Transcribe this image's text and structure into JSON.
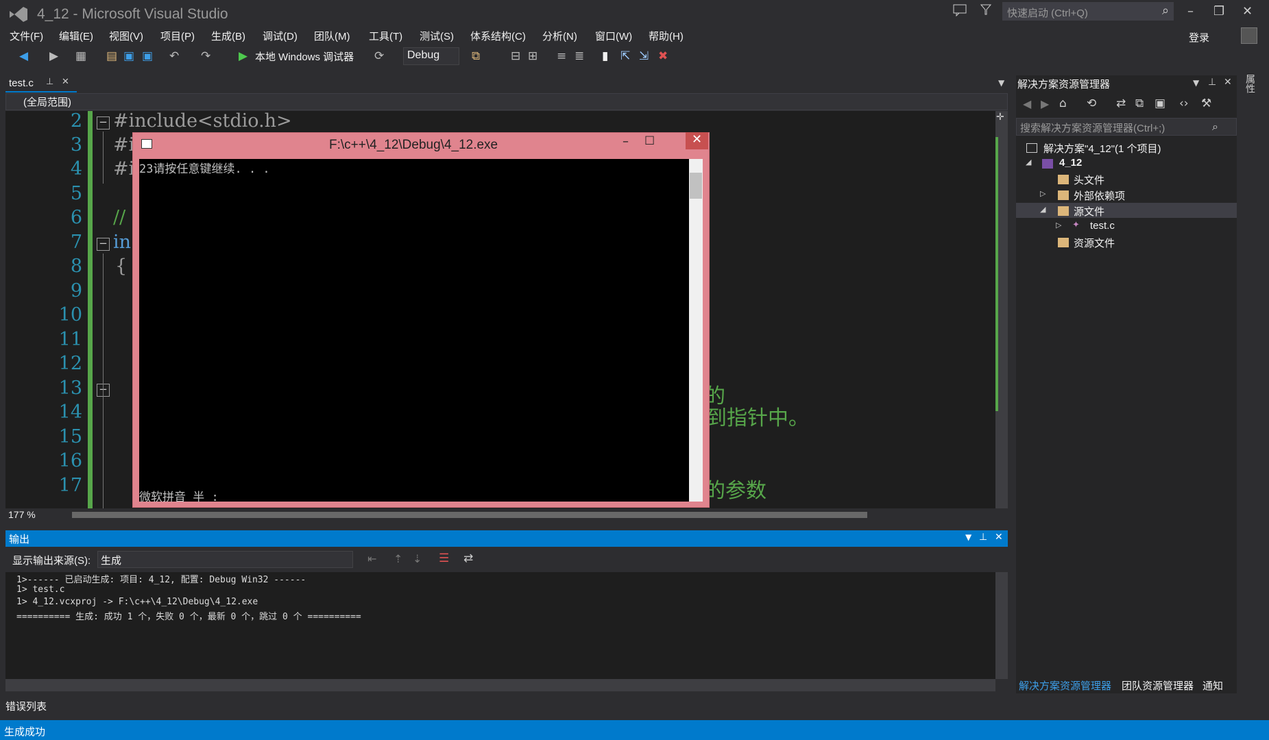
{
  "window": {
    "title": "4_12 - Microsoft Visual Studio",
    "quick_launch_placeholder": "快速启动 (Ctrl+Q)",
    "login": "登录"
  },
  "menu": [
    "文件(F)",
    "编辑(E)",
    "视图(V)",
    "项目(P)",
    "生成(B)",
    "调试(D)",
    "团队(M)",
    "工具(T)",
    "测试(S)",
    "体系结构(C)",
    "分析(N)",
    "窗口(W)",
    "帮助(H)"
  ],
  "toolbar": {
    "run_label": "本地 Windows 调试器",
    "config": "Debug"
  },
  "editor": {
    "tab": "test.c",
    "scope": "(全局范围)",
    "zoom": "177 %",
    "line_numbers": [
      "2",
      "3",
      "4",
      "5",
      "6",
      "7",
      "8",
      "9",
      "10",
      "11",
      "12",
      "13",
      "14",
      "15",
      "16",
      "17"
    ],
    "code": {
      "l2": "#include<stdio.h>",
      "l3": "#i",
      "l4": "#i",
      "l6": "//",
      "l7": "in",
      "l8": "{"
    },
    "comment_13": "的",
    "comment_14": "到指针中。",
    "comment_17": "的参数"
  },
  "console": {
    "title": "F:\\c++\\4_12\\Debug\\4_12.exe",
    "output": "23请按任意键继续. . .",
    "ime": "微软拼音 半 :"
  },
  "output_pane": {
    "title": "输出",
    "source_label": "显示输出来源(S):",
    "source_value": "生成",
    "lines": [
      "1>------ 已启动生成:  项目: 4_12, 配置: Debug Win32 ------",
      "1>  test.c",
      "1>  4_12.vcxproj -> F:\\c++\\4_12\\Debug\\4_12.exe",
      "========== 生成:  成功 1 个，失败 0 个，最新 0 个，跳过 0 个 =========="
    ],
    "error_list_tab": "错误列表"
  },
  "solution_explorer": {
    "title": "解决方案资源管理器",
    "search_placeholder": "搜索解决方案资源管理器(Ctrl+;)",
    "tree": {
      "solution": "解决方案\"4_12\"(1 个项目)",
      "project": "4_12",
      "headers": "头文件",
      "external": "外部依赖项",
      "sources": "源文件",
      "file": "test.c",
      "resources": "资源文件"
    },
    "bottom_tabs": [
      "解决方案资源管理器",
      "团队资源管理器",
      "通知"
    ],
    "side_strip": "属性"
  },
  "status": {
    "text": "生成成功"
  },
  "colors": {
    "accent": "#007acc",
    "console_frame": "#e0848e",
    "comment_green": "#57a64a",
    "line_number": "#2b91af"
  }
}
